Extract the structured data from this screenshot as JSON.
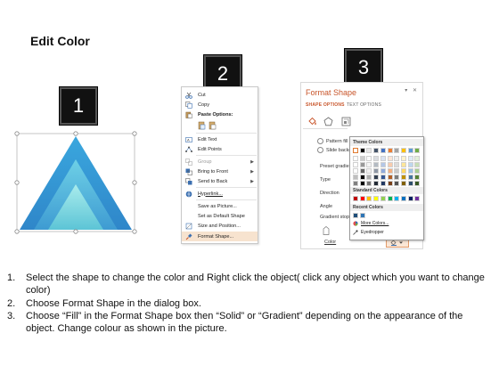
{
  "title": "Edit Color",
  "badges": [
    "1",
    "2",
    "3"
  ],
  "context_menu": {
    "items": [
      {
        "label": "Cut",
        "icon": "scissors-icon",
        "dim": false,
        "arrow": false
      },
      {
        "label": "Copy",
        "icon": "copy-icon",
        "dim": false,
        "arrow": false
      },
      {
        "label": "Paste Options:",
        "icon": "paste-icon",
        "dim": false,
        "arrow": false
      },
      {
        "label": "",
        "icon": "paste-options-icons",
        "dim": false,
        "arrow": false
      },
      {
        "label": "Edit Text",
        "icon": "edit-text-icon",
        "dim": false,
        "arrow": false
      },
      {
        "label": "Edit Points",
        "icon": "edit-points-icon",
        "dim": false,
        "arrow": false
      },
      {
        "label": "Group",
        "icon": "group-icon",
        "dim": true,
        "arrow": true
      },
      {
        "label": "Bring to Front",
        "icon": "bring-to-front-icon",
        "dim": false,
        "arrow": true
      },
      {
        "label": "Send to Back",
        "icon": "send-to-back-icon",
        "dim": false,
        "arrow": true
      },
      {
        "label": "Hyperlink...",
        "icon": "hyperlink-icon",
        "dim": false,
        "arrow": false
      },
      {
        "label": "Save as Picture...",
        "icon": "",
        "dim": false,
        "arrow": false
      },
      {
        "label": "Set as Default Shape",
        "icon": "",
        "dim": false,
        "arrow": false
      },
      {
        "label": "Size and Position...",
        "icon": "size-position-icon",
        "dim": false,
        "arrow": false
      },
      {
        "label": "Format Shape...",
        "icon": "format-shape-icon",
        "dim": false,
        "arrow": false,
        "highlight": true
      }
    ]
  },
  "format_pane": {
    "title": "Format Shape",
    "controls": "▾ ✕",
    "tabs": {
      "shape_options": "SHAPE OPTIONS",
      "text_options": "TEXT OPTIONS"
    },
    "options": [
      "Pattern fill",
      "Slide backgr"
    ],
    "labels": [
      "Preset gradie",
      "Type",
      "Direction",
      "Angle",
      "Gradient stop",
      "Color"
    ]
  },
  "color_picker": {
    "theme_header": "Theme Colors",
    "standard_header": "Standard Colors",
    "recent_header": "Recent Colors",
    "more_colors": "More Colors...",
    "eyedropper": "Eyedropper",
    "theme_top": [
      "#ffffff",
      "#000000",
      "#e7e6e6",
      "#44546a",
      "#4472c4",
      "#ed7d31",
      "#a5a5a5",
      "#ffc000",
      "#5b9bd5",
      "#70ad47"
    ],
    "standard": [
      "#c00000",
      "#ff0000",
      "#ffc000",
      "#ffff00",
      "#92d050",
      "#00b050",
      "#00b0f0",
      "#0070c0",
      "#002060",
      "#7030a0"
    ],
    "recent": [
      "#1f4e79",
      "#2e75b6"
    ]
  },
  "instructions": [
    {
      "num": "1.",
      "text": "Select the shape to change the color and Right click the object( click any object which you want to change color)"
    },
    {
      "num": "2.",
      "text": "Choose Format Shape in the dialog box."
    },
    {
      "num": "3.",
      "text": "Choose “Fill” in the Format Shape box then “Solid” or “Gradient” depending on the appearance of the object. Change colour as shown in the picture."
    }
  ]
}
